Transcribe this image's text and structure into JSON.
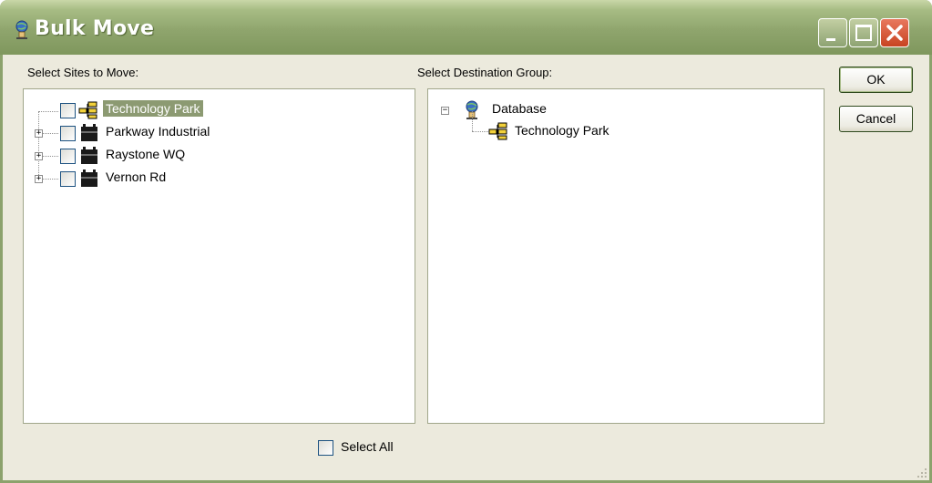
{
  "window": {
    "title": "Bulk Move",
    "title_icon": "globe-person-icon",
    "controls": [
      "minimize",
      "maximize",
      "close"
    ]
  },
  "left_panel": {
    "label": "Select Sites to Move:",
    "items": [
      {
        "label": "Technology Park",
        "icon": "group-network-icon",
        "selected": true,
        "expandable": false,
        "checked": false
      },
      {
        "label": "Parkway Industrial",
        "icon": "site-building-icon",
        "selected": false,
        "expandable": true,
        "checked": false
      },
      {
        "label": "Raystone WQ",
        "icon": "site-building-icon",
        "selected": false,
        "expandable": true,
        "checked": false
      },
      {
        "label": "Vernon Rd",
        "icon": "site-building-icon",
        "selected": false,
        "expandable": true,
        "checked": false
      }
    ]
  },
  "right_panel": {
    "label": "Select Destination Group:",
    "root": {
      "label": "Database",
      "icon": "globe-person-icon",
      "expanded": true
    },
    "children": [
      {
        "label": "Technology Park",
        "icon": "group-network-icon"
      }
    ]
  },
  "buttons": {
    "ok": "OK",
    "cancel": "Cancel"
  },
  "select_all": {
    "label": "Select All",
    "checked": false
  },
  "colors": {
    "titlebar": "#8fa56d",
    "window_bg": "#eceadd",
    "selection": "#8c9a72",
    "close_button": "#c84422"
  }
}
